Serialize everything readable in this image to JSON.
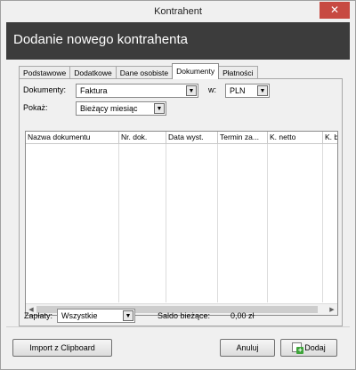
{
  "window": {
    "title": "Kontrahent",
    "close_glyph": "✕"
  },
  "header": {
    "title": "Dodanie nowego kontrahenta"
  },
  "tabs": [
    {
      "label": "Podstawowe",
      "active": false
    },
    {
      "label": "Dodatkowe",
      "active": false
    },
    {
      "label": "Dane osobiste",
      "active": false
    },
    {
      "label": "Dokumenty",
      "active": true
    },
    {
      "label": "Płatności",
      "active": false
    }
  ],
  "filters": {
    "documents_label": "Dokumenty:",
    "documents_value": "Faktura",
    "currency_label": "w:",
    "currency_value": "PLN",
    "show_label": "Pokaż:",
    "show_value": "Bieżący miesiąc"
  },
  "table": {
    "columns": [
      "Nazwa dokumentu",
      "Nr. dok.",
      "Data wyst.",
      "Termin za...",
      "K. netto",
      "K. b"
    ],
    "rows": []
  },
  "summary": {
    "payments_label": "Zapłaty:",
    "payments_value": "Wszystkie",
    "balance_label": "Saldo bieżące:",
    "balance_value": "0,00 zł"
  },
  "buttons": {
    "import": "Import z Clipboard",
    "cancel": "Anuluj",
    "add": "Dodaj"
  },
  "icons": {
    "dropdown": "chevron-down-icon",
    "add": "add-document-icon"
  },
  "colors": {
    "header_bg": "#3c3c3c",
    "close_bg": "#c74a42"
  }
}
